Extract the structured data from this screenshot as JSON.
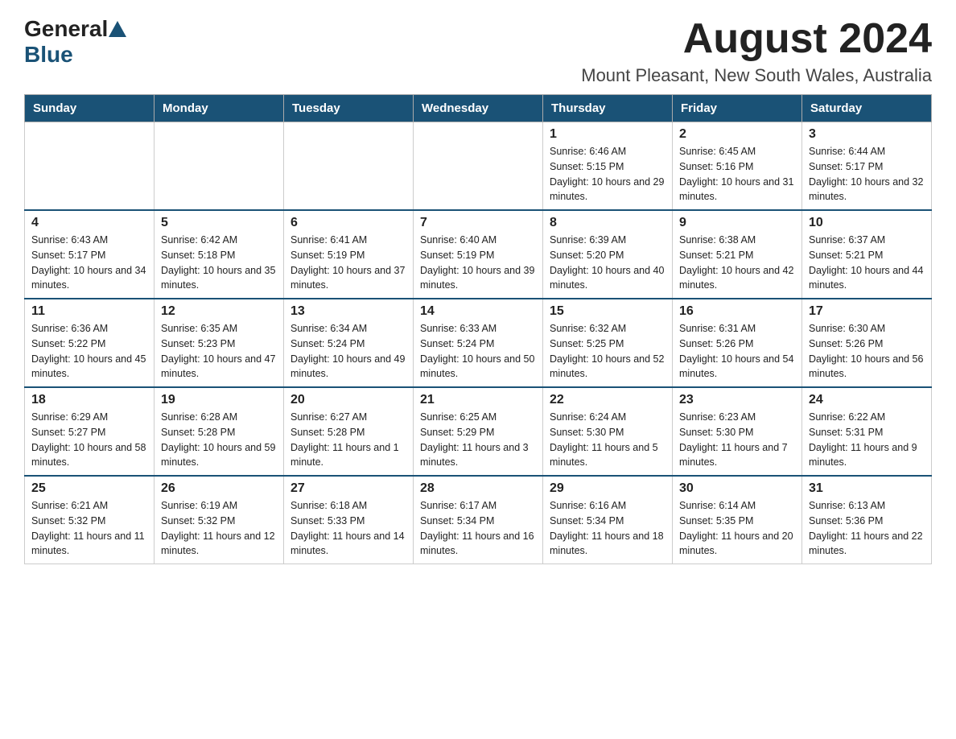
{
  "header": {
    "logo_general": "General",
    "logo_blue": "Blue",
    "month_title": "August 2024",
    "location": "Mount Pleasant, New South Wales, Australia"
  },
  "weekdays": [
    "Sunday",
    "Monday",
    "Tuesday",
    "Wednesday",
    "Thursday",
    "Friday",
    "Saturday"
  ],
  "weeks": [
    [
      {
        "day": "",
        "info": ""
      },
      {
        "day": "",
        "info": ""
      },
      {
        "day": "",
        "info": ""
      },
      {
        "day": "",
        "info": ""
      },
      {
        "day": "1",
        "info": "Sunrise: 6:46 AM\nSunset: 5:15 PM\nDaylight: 10 hours and 29 minutes."
      },
      {
        "day": "2",
        "info": "Sunrise: 6:45 AM\nSunset: 5:16 PM\nDaylight: 10 hours and 31 minutes."
      },
      {
        "day": "3",
        "info": "Sunrise: 6:44 AM\nSunset: 5:17 PM\nDaylight: 10 hours and 32 minutes."
      }
    ],
    [
      {
        "day": "4",
        "info": "Sunrise: 6:43 AM\nSunset: 5:17 PM\nDaylight: 10 hours and 34 minutes."
      },
      {
        "day": "5",
        "info": "Sunrise: 6:42 AM\nSunset: 5:18 PM\nDaylight: 10 hours and 35 minutes."
      },
      {
        "day": "6",
        "info": "Sunrise: 6:41 AM\nSunset: 5:19 PM\nDaylight: 10 hours and 37 minutes."
      },
      {
        "day": "7",
        "info": "Sunrise: 6:40 AM\nSunset: 5:19 PM\nDaylight: 10 hours and 39 minutes."
      },
      {
        "day": "8",
        "info": "Sunrise: 6:39 AM\nSunset: 5:20 PM\nDaylight: 10 hours and 40 minutes."
      },
      {
        "day": "9",
        "info": "Sunrise: 6:38 AM\nSunset: 5:21 PM\nDaylight: 10 hours and 42 minutes."
      },
      {
        "day": "10",
        "info": "Sunrise: 6:37 AM\nSunset: 5:21 PM\nDaylight: 10 hours and 44 minutes."
      }
    ],
    [
      {
        "day": "11",
        "info": "Sunrise: 6:36 AM\nSunset: 5:22 PM\nDaylight: 10 hours and 45 minutes."
      },
      {
        "day": "12",
        "info": "Sunrise: 6:35 AM\nSunset: 5:23 PM\nDaylight: 10 hours and 47 minutes."
      },
      {
        "day": "13",
        "info": "Sunrise: 6:34 AM\nSunset: 5:24 PM\nDaylight: 10 hours and 49 minutes."
      },
      {
        "day": "14",
        "info": "Sunrise: 6:33 AM\nSunset: 5:24 PM\nDaylight: 10 hours and 50 minutes."
      },
      {
        "day": "15",
        "info": "Sunrise: 6:32 AM\nSunset: 5:25 PM\nDaylight: 10 hours and 52 minutes."
      },
      {
        "day": "16",
        "info": "Sunrise: 6:31 AM\nSunset: 5:26 PM\nDaylight: 10 hours and 54 minutes."
      },
      {
        "day": "17",
        "info": "Sunrise: 6:30 AM\nSunset: 5:26 PM\nDaylight: 10 hours and 56 minutes."
      }
    ],
    [
      {
        "day": "18",
        "info": "Sunrise: 6:29 AM\nSunset: 5:27 PM\nDaylight: 10 hours and 58 minutes."
      },
      {
        "day": "19",
        "info": "Sunrise: 6:28 AM\nSunset: 5:28 PM\nDaylight: 10 hours and 59 minutes."
      },
      {
        "day": "20",
        "info": "Sunrise: 6:27 AM\nSunset: 5:28 PM\nDaylight: 11 hours and 1 minute."
      },
      {
        "day": "21",
        "info": "Sunrise: 6:25 AM\nSunset: 5:29 PM\nDaylight: 11 hours and 3 minutes."
      },
      {
        "day": "22",
        "info": "Sunrise: 6:24 AM\nSunset: 5:30 PM\nDaylight: 11 hours and 5 minutes."
      },
      {
        "day": "23",
        "info": "Sunrise: 6:23 AM\nSunset: 5:30 PM\nDaylight: 11 hours and 7 minutes."
      },
      {
        "day": "24",
        "info": "Sunrise: 6:22 AM\nSunset: 5:31 PM\nDaylight: 11 hours and 9 minutes."
      }
    ],
    [
      {
        "day": "25",
        "info": "Sunrise: 6:21 AM\nSunset: 5:32 PM\nDaylight: 11 hours and 11 minutes."
      },
      {
        "day": "26",
        "info": "Sunrise: 6:19 AM\nSunset: 5:32 PM\nDaylight: 11 hours and 12 minutes."
      },
      {
        "day": "27",
        "info": "Sunrise: 6:18 AM\nSunset: 5:33 PM\nDaylight: 11 hours and 14 minutes."
      },
      {
        "day": "28",
        "info": "Sunrise: 6:17 AM\nSunset: 5:34 PM\nDaylight: 11 hours and 16 minutes."
      },
      {
        "day": "29",
        "info": "Sunrise: 6:16 AM\nSunset: 5:34 PM\nDaylight: 11 hours and 18 minutes."
      },
      {
        "day": "30",
        "info": "Sunrise: 6:14 AM\nSunset: 5:35 PM\nDaylight: 11 hours and 20 minutes."
      },
      {
        "day": "31",
        "info": "Sunrise: 6:13 AM\nSunset: 5:36 PM\nDaylight: 11 hours and 22 minutes."
      }
    ]
  ]
}
